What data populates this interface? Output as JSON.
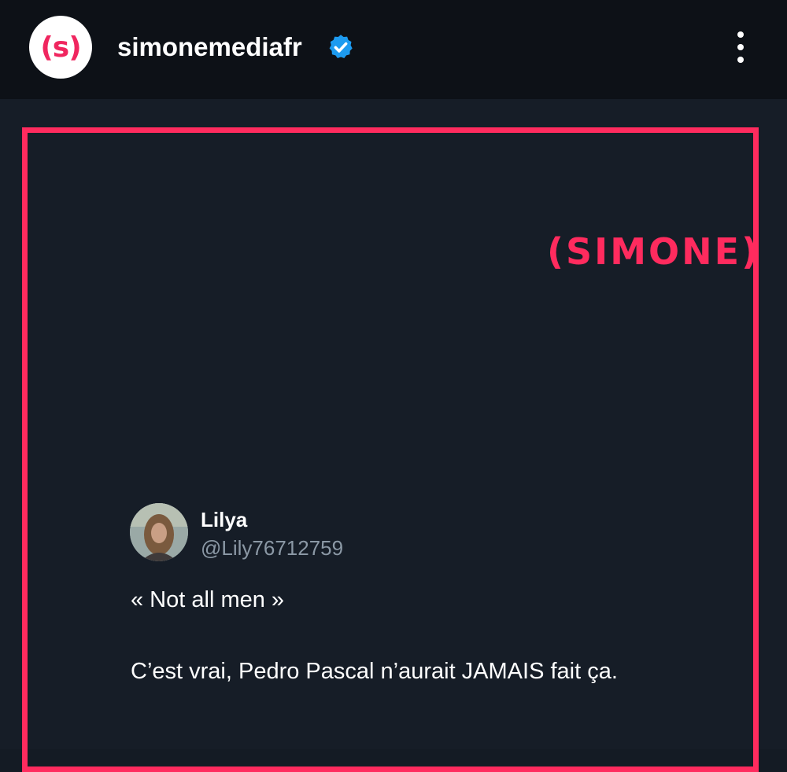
{
  "header": {
    "avatar_text": "(s)",
    "username": "simonemediafr",
    "verified_icon": "verified-badge-icon",
    "more_icon": "more-vertical-icon"
  },
  "post": {
    "brand_logo": "(SIMONE)",
    "tweet": {
      "name": "Lilya",
      "handle": "@Lily76712759",
      "line1": "« Not all men »",
      "line2": "C’est vrai, Pedro Pascal n’aurait JAMAIS fait ça."
    }
  },
  "colors": {
    "header_bg": "#0d1117",
    "post_bg": "#161d27",
    "accent": "#ff2b5e",
    "verified": "#1d9bf0",
    "handle": "#8b98a5"
  }
}
